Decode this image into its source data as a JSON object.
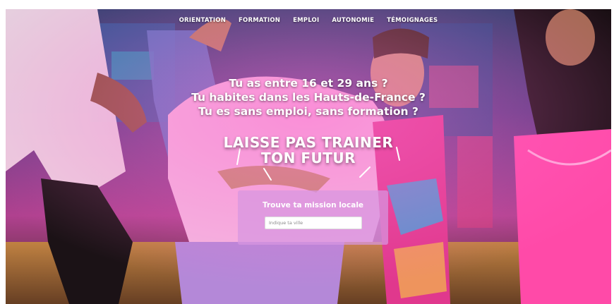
{
  "nav": {
    "items": [
      "ORIENTATION",
      "FORMATION",
      "EMPLOI",
      "AUTONOMIE",
      "TÉMOIGNAGES"
    ]
  },
  "hero": {
    "headline": [
      "Tu as entre 16 et 29 ans ?",
      "Tu habites dans les Hauts-de-France ?",
      "Tu es sans emploi, sans formation ?"
    ],
    "slogan": [
      "LAISSE PAS TRAINER",
      "TON FUTUR"
    ]
  },
  "search": {
    "title": "Trouve ta mission locale",
    "placeholder": "Indique ta ville",
    "value": ""
  },
  "colors": {
    "accent": "#ff3fb0",
    "card": "#d796e1",
    "stage_floor": "#d8a64a"
  }
}
